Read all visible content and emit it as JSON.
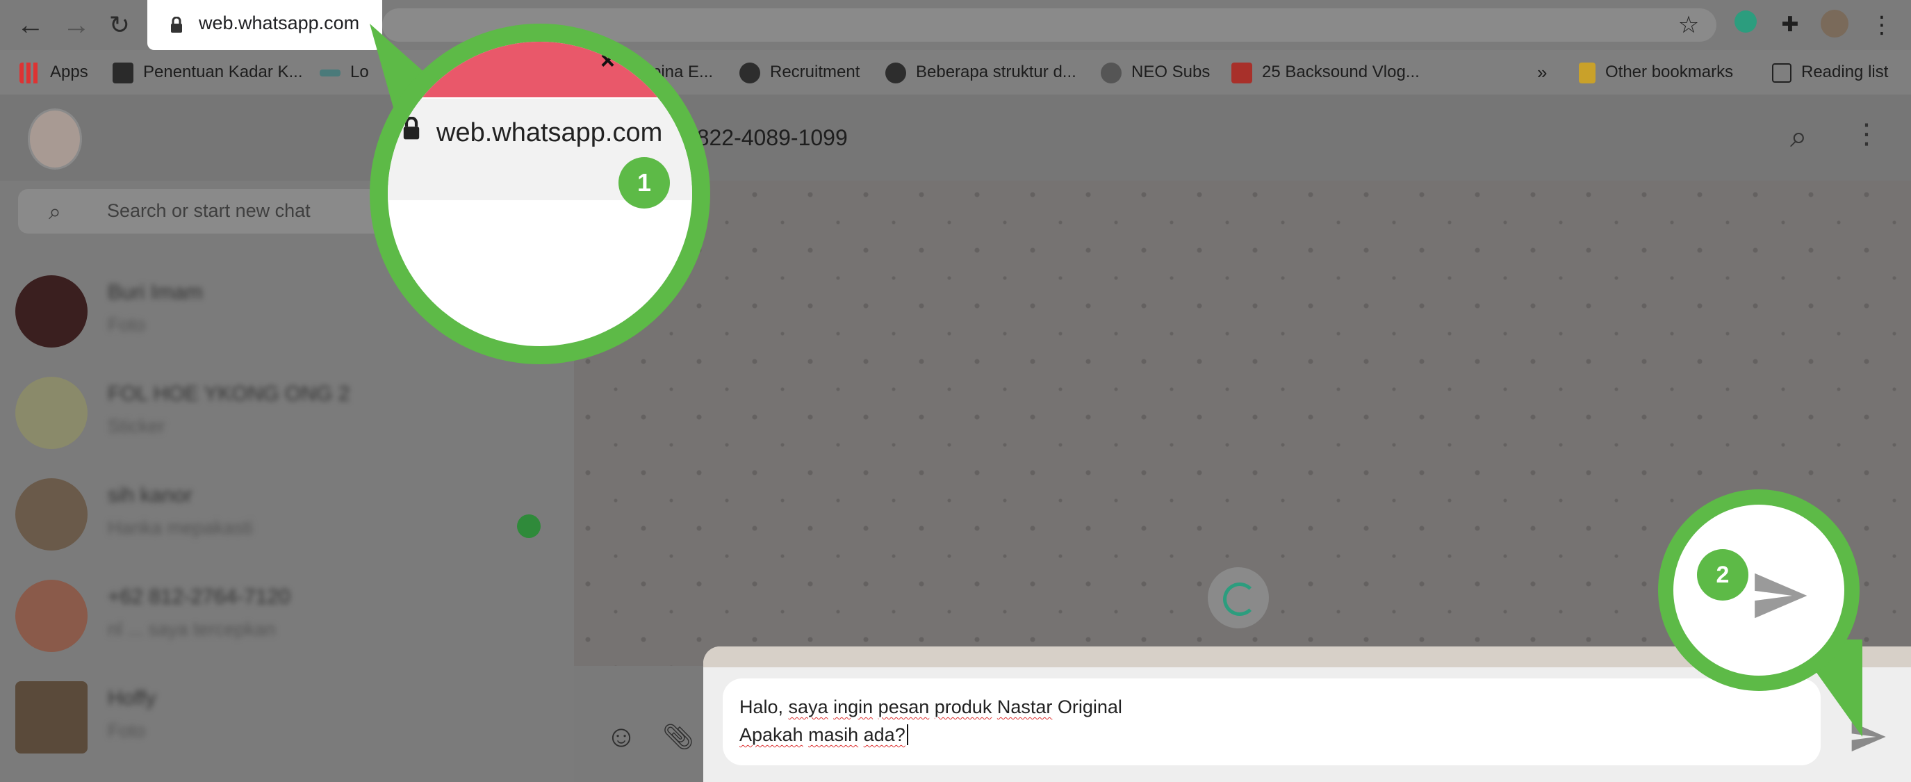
{
  "browser": {
    "url": "web.whatsapp.com",
    "bookmarks": [
      {
        "label": "Apps",
        "icon": "apps-grid-icon"
      },
      {
        "label": "Penentuan Kadar K...",
        "icon": "bookmark-thumb-icon"
      },
      {
        "label": "Lo",
        "icon": "bookmark-kko-icon"
      },
      {
        "label": "pina E...",
        "icon": "bookmark-icon"
      },
      {
        "label": "Recruitment",
        "icon": "globe-icon"
      },
      {
        "label": "Beberapa struktur d...",
        "icon": "globe-icon"
      },
      {
        "label": "NEO Subs",
        "icon": "neo-logo-icon"
      },
      {
        "label": "25 Backsound Vlog...",
        "icon": "bookmark-red-icon"
      }
    ],
    "overflow_label": "»",
    "other_bookmarks": "Other bookmarks",
    "reading_list": "Reading list"
  },
  "whatsapp": {
    "search_placeholder": "Search or start new chat",
    "chat_title": "2 822-4089-1099",
    "chats": [
      {
        "name": "Buri Imam",
        "preview": "Foto"
      },
      {
        "name": "FOL HOE YKONG ONG 2",
        "preview": "Sticker"
      },
      {
        "name": "sih kanor",
        "preview": "Hanka mepakasti"
      },
      {
        "name": "+62 812-2764-7120",
        "preview": "nl ... saya tercepkan"
      },
      {
        "name": "Hoffy",
        "preview": "Foto"
      }
    ],
    "message_line1_words": [
      "Halo,",
      "saya",
      "ingin",
      "pesan",
      "produk",
      "Nastar",
      "Original"
    ],
    "message_line2_words": [
      "Apakah",
      "masih",
      "ada?"
    ]
  },
  "callouts": {
    "step1": "1",
    "step2": "2",
    "zoom_url": "web.whatsapp.com",
    "close_glyph": "×"
  },
  "colors": {
    "callout_green": "#5dba47",
    "tab_red": "#e9586a",
    "spinner_teal": "#2c9d7e"
  }
}
